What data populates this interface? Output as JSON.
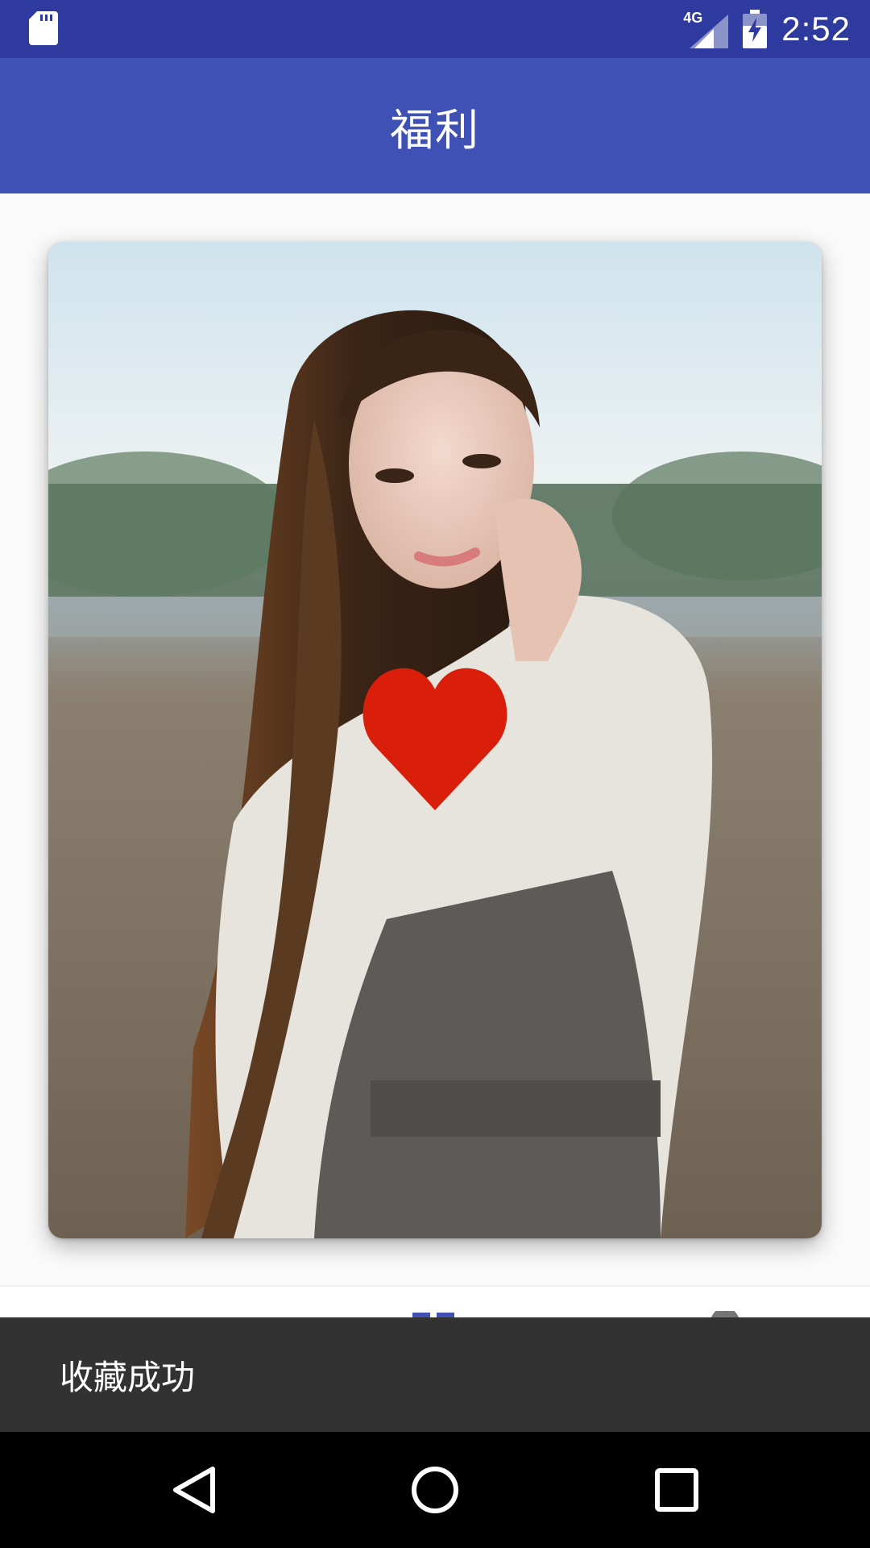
{
  "status_bar": {
    "time": "2:52",
    "network": "4G",
    "icons": [
      "sd-card-icon",
      "signal-icon",
      "battery-charging-icon"
    ]
  },
  "toolbar": {
    "title": "福利"
  },
  "card": {
    "image_icon": "photo",
    "overlay_icon": "heart-icon",
    "heart_color": "#d91e0a"
  },
  "bottom_nav": {
    "icons": [
      "grid-icon",
      "profile-icon"
    ],
    "accent": "#3f51b5"
  },
  "snackbar": {
    "message": "收藏成功"
  },
  "system_nav": {
    "icons": [
      "back-icon",
      "home-icon",
      "recents-icon"
    ]
  },
  "colors": {
    "status_bar": "#2f3a9e",
    "toolbar": "#3f51b5",
    "snackbar": "#323232"
  }
}
